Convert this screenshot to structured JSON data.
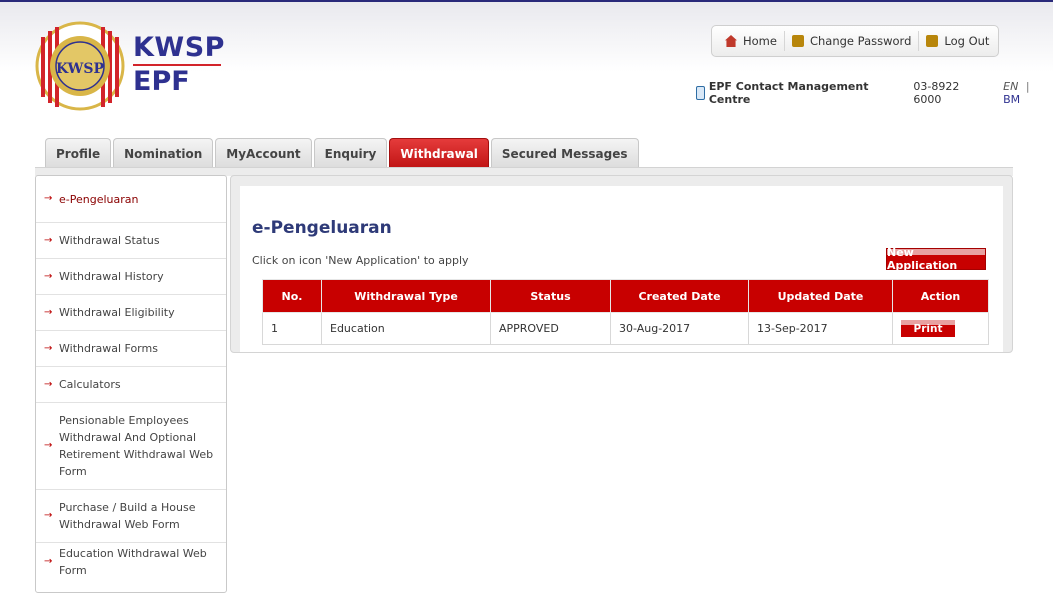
{
  "brand": {
    "line1": "KWSP",
    "line2": "EPF",
    "logo_text": "KWSP",
    "colors": {
      "navy": "#2e3190",
      "red": "#d2232a",
      "gold": "#d9b648"
    }
  },
  "topnav": {
    "home": "Home",
    "change_password": "Change Password",
    "logout": "Log Out"
  },
  "contact": {
    "label": "EPF Contact Management Centre",
    "phone": "03-8922 6000",
    "lang_en": "EN",
    "lang_sep": "|",
    "lang_bm": "BM"
  },
  "tabs": [
    {
      "label": "Profile",
      "active": false
    },
    {
      "label": "Nomination",
      "active": false
    },
    {
      "label": "MyAccount",
      "active": false
    },
    {
      "label": "Enquiry",
      "active": false
    },
    {
      "label": "Withdrawal",
      "active": true
    },
    {
      "label": "Secured Messages",
      "active": false
    }
  ],
  "sidebar": {
    "items": [
      {
        "label": "e-Pengeluaran",
        "active": true
      },
      {
        "label": "Withdrawal Status"
      },
      {
        "label": "Withdrawal History"
      },
      {
        "label": "Withdrawal Eligibility"
      },
      {
        "label": "Withdrawal Forms"
      },
      {
        "label": "Calculators"
      },
      {
        "label": "Pensionable Employees Withdrawal And Optional Retirement Withdrawal Web Form"
      },
      {
        "label": "Purchase / Build a House Withdrawal Web Form"
      },
      {
        "label": "Education Withdrawal Web Form"
      }
    ]
  },
  "main": {
    "title": "e-Pengeluaran",
    "hint": "Click on icon 'New Application' to apply",
    "new_button": "New Application",
    "table": {
      "headers": [
        "No.",
        "Withdrawal Type",
        "Status",
        "Created Date",
        "Updated Date",
        "Action"
      ],
      "rows": [
        {
          "no": "1",
          "type": "Education",
          "status": "APPROVED",
          "created": "30-Aug-2017",
          "updated": "13-Sep-2017",
          "action": "Print"
        }
      ]
    }
  }
}
